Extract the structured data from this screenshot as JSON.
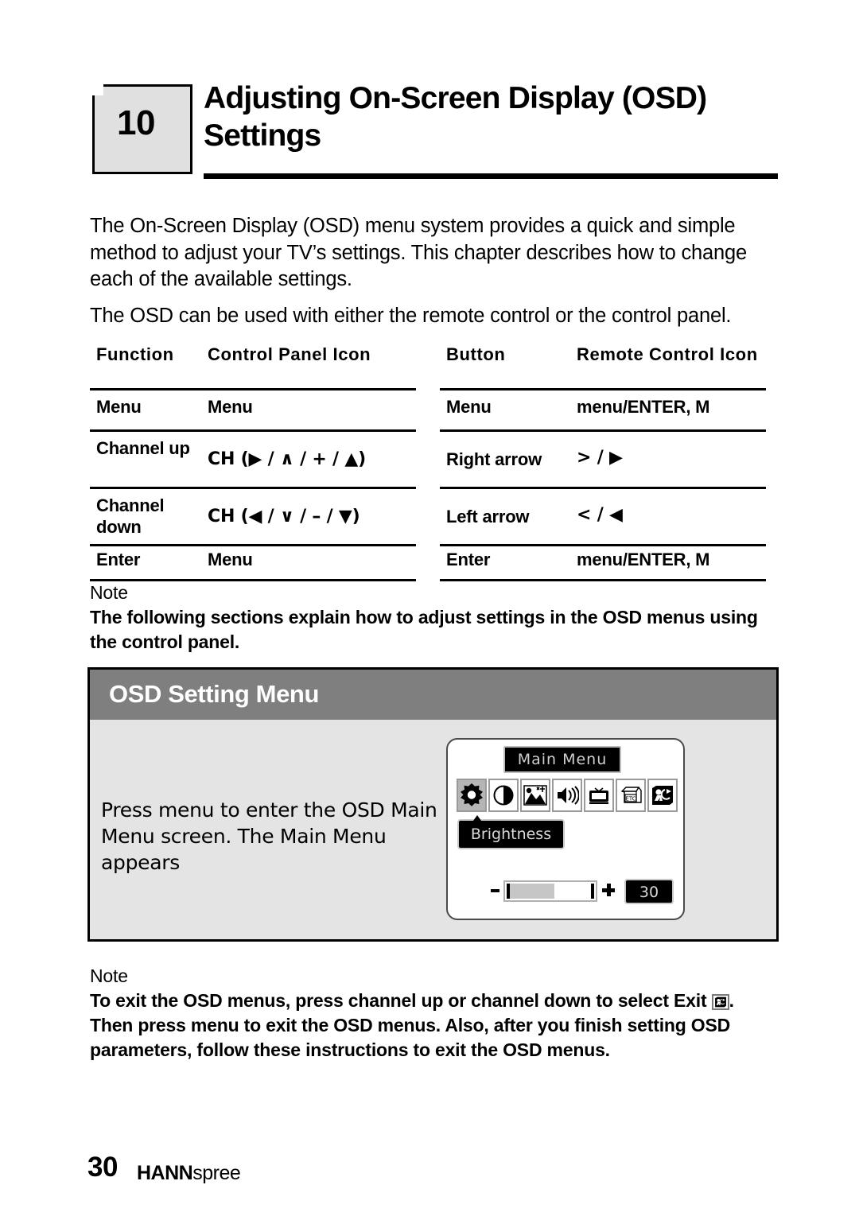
{
  "chapter": {
    "number": "10",
    "title": "Adjusting On-Screen Display (OSD) Settings"
  },
  "intro": {
    "paragraph_1": "The On-Screen Display (OSD) menu system provides a quick and simple method to adjust your TV’s settings. This chapter describes how to change each of the available settings.",
    "paragraph_2": "The OSD can be used with either the remote control or the control panel."
  },
  "control_table": {
    "left": {
      "headers": [
        "Function",
        "Control Panel Icon"
      ],
      "rows": [
        {
          "function": "Menu",
          "icon": "Menu"
        },
        {
          "function": "Channel up",
          "icon": "CH (▶ / ∧ / + / ▲)"
        },
        {
          "function": "Channel down",
          "icon": "CH (◀ / ∨ / – / ▼)"
        },
        {
          "function": "Enter",
          "icon": "Menu"
        }
      ]
    },
    "right": {
      "headers": [
        "Button",
        "Remote Control Icon"
      ],
      "rows": [
        {
          "button": "Menu",
          "icon": "menu/ENTER, M"
        },
        {
          "button": "Right arrow",
          "icon": "> / ▶"
        },
        {
          "button": "Left arrow",
          "icon": "< / ◀"
        },
        {
          "button": "Enter",
          "icon": "menu/ENTER, M"
        }
      ]
    }
  },
  "note_1": {
    "label": "Note",
    "body": "The following sections explain how to adjust settings in the OSD menus using the control panel."
  },
  "osd_section": {
    "title": "OSD Setting Menu",
    "instruction": "Press menu to enter the OSD Main Menu screen. The Main Menu appears",
    "screen": {
      "title_bar": "Main Menu",
      "icons": [
        {
          "name": "brightness-icon",
          "selected": true
        },
        {
          "name": "contrast-icon",
          "selected": false
        },
        {
          "name": "picture-icon",
          "selected": false
        },
        {
          "name": "volume-icon",
          "selected": false
        },
        {
          "name": "screen-icon",
          "selected": false
        },
        {
          "name": "etc-icon",
          "label": "ETC",
          "selected": false
        },
        {
          "name": "exit-icon",
          "selected": false
        }
      ],
      "selected_label": "Brightness",
      "slider": {
        "minus": "−",
        "plus": "+",
        "fill_percent": 55
      },
      "value": "30"
    },
    "colors": {
      "header_bar": "#7f7f7f",
      "panel_background": "#e4e4e4",
      "selected_icon": "#b5b5b5"
    }
  },
  "note_2": {
    "label": "Note",
    "body_part_1": "To exit the OSD menus, press channel up or channel down to select Exit",
    "body_part_2": ". Then press menu to exit the OSD menus. Also, after you finish setting OSD parameters, follow these instructions to exit the OSD menus."
  },
  "footer": {
    "page_number": "30",
    "brand_bold": "HANN",
    "brand_light": "spree"
  }
}
